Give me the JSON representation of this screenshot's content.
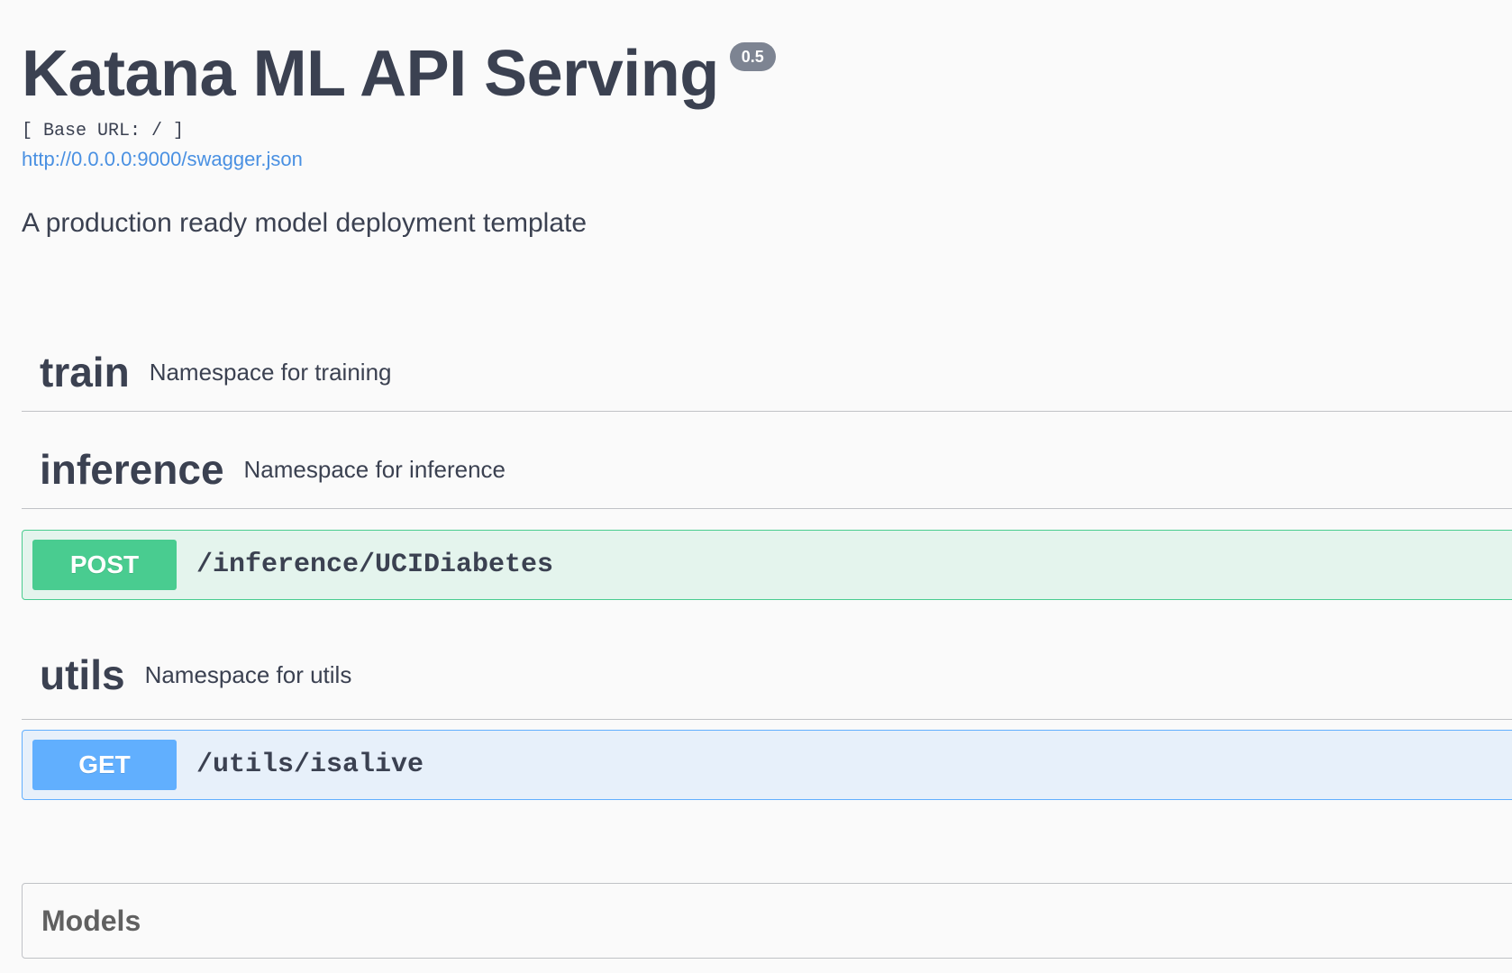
{
  "info": {
    "title": "Katana ML API Serving",
    "version": "0.5",
    "base_url": "[ Base URL: / ]",
    "spec_link": "http://0.0.0.0:9000/swagger.json",
    "description": "A production ready model deployment template"
  },
  "tags": [
    {
      "name": "train",
      "description": "Namespace for training",
      "operations": []
    },
    {
      "name": "inference",
      "description": "Namespace for inference",
      "operations": [
        {
          "method": "POST",
          "path": "/inference/UCIDiabetes"
        }
      ]
    },
    {
      "name": "utils",
      "description": "Namespace for utils",
      "operations": [
        {
          "method": "GET",
          "path": "/utils/isalive"
        }
      ]
    }
  ],
  "models": {
    "title": "Models"
  },
  "colors": {
    "post": "#49cc90",
    "get": "#61affe",
    "link": "#4990e2",
    "text": "#3b4151",
    "badge": "#7d8492"
  }
}
